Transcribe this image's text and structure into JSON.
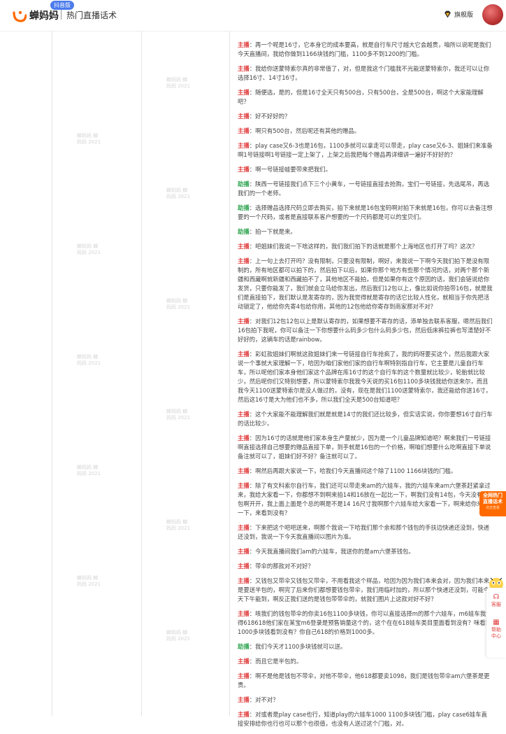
{
  "header": {
    "logo_text": "蝉妈妈",
    "logo_badge": "抖音版",
    "page_title": "热门直播话术",
    "vip_label": "旗舰版"
  },
  "watermark": "蝉妈妈 蝉妈妈 2021",
  "icons": {
    "logo": "cicada-logo-icon",
    "vip": "diamond-icon",
    "caret": "chevron-down-icon",
    "mascot": "mascot-icon"
  },
  "colors": {
    "host": "#e03b3b",
    "assistant": "#2da44e",
    "accent": "#ff6a00"
  },
  "roles": {
    "host": "主播",
    "assistant": "助播"
  },
  "transcript": [
    {
      "role": "host",
      "text": "：再一个呢是16寸，它本身它的成本要高，就是自行车尺寸越大它会越贵，咱所以说呢是我们今天直播间，我给你做到1166块钱的门槛，1100多不到1200的门槛。"
    },
    {
      "role": "host",
      "text": "：我给你送蒙特索尔真的非常值了，对，但是我这个门槛我不光能送蒙特索尔，我还可以让你选择16寸、14寸16寸。"
    },
    {
      "role": "host",
      "text": "：随便选，是的，但是16寸全天只有500台，只有500台，全是500台，啊这个大家能理解吧？"
    },
    {
      "role": "host",
      "text": "：好不好好的？"
    },
    {
      "role": "host",
      "text": "：啊只有500台，然后呢还有其他的赠品。"
    },
    {
      "role": "host",
      "text": "：play case又6-3也是16包，1100多就可以拿走可以带走，play case又6-3、姐妹们来准备啊1号链接啊1号链接一定上架了，上架之后我把每个赠品再详细讲一遍好不好好的？"
    },
    {
      "role": "host",
      "text": "：啊一号链接蛙要带来把我们。"
    },
    {
      "role": "asst",
      "text": "：陕西一号链接我们点下三个小黄车，一号链接直接去抢购，宝们一号链接，先选尾吊，再选我们的一个老师。"
    },
    {
      "role": "asst",
      "text": "：选择赠品选择尺码立即去购买，拍下来就是16包宝码啊对拍下来就是16包，你可以去备注想要的一个尺码，或者是直接联系客户想要的一个尺码都是可以的宝贝们。"
    },
    {
      "role": "asst",
      "text": "：拍一下就是来。"
    },
    {
      "role": "host",
      "text": "：吧姐妹们我说一下啥这样的，我们我们拍下的话就是那个上海地区也打开了吗？这次？"
    },
    {
      "role": "host",
      "text": "：上一句上去打开吗？没有限制，只要没有限制，啊好，来我说一下啊今天我们拍下是没有限制的，所有地区都可以拍下的，然后拍下以后，如果你那个地方有些那个情况的话，对两个那个新疆和西藏啊就新疆和西藏拍不了，其他地区不能拍，但是如果你有这个原因的话，我们会链说给你发货，只要你能发了，我们就会立马给你发出，然后我们12包以上，像比如说你拍带16包，就是我们是直接拍下，我们默认是发寄存的，因为我觉得就是寄存的话它比较人性化，就相当于你先把活动锁定了，他给你先寄4包给你用，其他的12包他给你寄存到商家那对不对？"
    },
    {
      "role": "host",
      "text": "：对我们12包12包以上是默认寄存的，如果想要不寄存的话，添单独去联系客服，嗯然后我们16包拍下我呢，你可以备注一下你想要什么码多少包什么码多少包，然后低床裤拉裤也写清楚好不好好的，这辆车的话是rainbow。"
    },
    {
      "role": "host",
      "text": "：彩虹款姐妹们啊就这款姐妹们来一号链接自行车抢疯了，我的妈呀要买这个，然后我跟大家说一个事就大家理解一下，哈因为咱们家他们家的自行车啊特别指自行车，它主要是儿童自行车车，所以呢他们家本身他们家这个品牌在库16寸的这个自行车的这个数量就比较少，轮胎就比较少，然后呢你们又特别想要，所以蒙特索尔我我今天说的买16包1100多块钱我给你送来尔，而且我今天1100送蒙特索尔是没人做过的，没有，现在是我们1100送蒙特索尔，我还能给你送16寸，然后这16寸是大为他们也不多，所以我们全天是500台知道吧？"
    },
    {
      "role": "host",
      "text": "：这个大家能不能理解我们就是就是14寸的我们还比较多，但实话实说，你你要想16寸自行车的话比较少。"
    },
    {
      "role": "host",
      "text": "：因为16寸的话就是他们家本身生产量就少，因为是一个儿童品牌知道吧？啊来我们一号链接啊直接选择自己想要的赠品直接下单，到手就是16包的一个价格，啊咱们想要什么吃啊直接下单说备注就可以了，姐妹们好不好？备注就可以了。"
    },
    {
      "role": "host",
      "text": "：啊然后再跟大家说一下，哈我们今天直播间这个除了1100 1166块钱的门槛。"
    },
    {
      "role": "host",
      "text": "：除了有文科索尔自行车，我们还可以带走来am的六娃车，我的六娃车来am六堡茶赶紧拿过来，我给大家看一下，你都想不到啊来拍14和16放在一起比一下，啊我们没有14包，今天没有14包啊开开，我上面上面是个总的啊是不是14 16尺寸我啊那个六娃车给大家看一下，啊来给你来看一下，来看到没有？"
    },
    {
      "role": "host",
      "text": "：下来把这个吧吧送来，啊那个我说一下哈我们那个余和那个钱包的手扶边快递还没到，快递还没到，我说一下今天我直播间以图片为准。"
    },
    {
      "role": "host",
      "text": "：今天我直播间我们am的六娃车，我送你的是am六堡茶钱包。"
    },
    {
      "role": "host",
      "text": "：带伞的那款对不对好？"
    },
    {
      "role": "host",
      "text": "：又钱包又带伞又钱包又带伞，不用看我这个样品，哈因为因为我们本来会对，因为我们本来是要送半包的，啊完了后来你们都想要钱包带伞，我们用临时加的，所以那个快递还没到，可能今天下午能到，啊反正我们送的是钱包带带伞的，就我们图片上这款对好不好？"
    },
    {
      "role": "host",
      "text": "：咳我们的钱包带伞的你卖16包1100多块钱，你可以直接选择m的那个六娃车，m6娃车我记得618618他们家在某宝m6登录是预售销量这个的，这个在在618娃车类目里面看到没有？咪看到1000多块钱看到没有？你自己618的价格到1000多。"
    },
    {
      "role": "asst",
      "text": "：我们今天才1100多块钱就可以送。"
    },
    {
      "role": "host",
      "text": "：而且它是半包的。"
    },
    {
      "role": "host",
      "text": "：啊不是他是钱包不带伞，对他不带伞，他618都要卖1098，我们是钱包带伞am六堡茶是更贵。"
    },
    {
      "role": "host",
      "text": "：对不对？"
    },
    {
      "role": "host",
      "text": "：对或者是play case也行，知道play的六娃车1000 1100多块钱门槛，play case6娃车直接安排给你也行也可以那个也很值，也没有人送过这个门槛，对。"
    }
  ],
  "promo": {
    "line1": "全网热门",
    "line2": "直播话术",
    "sub": "点击查看"
  },
  "side_panel": {
    "service_label": "客服",
    "help_label1": "帮助",
    "help_label2": "中心"
  }
}
